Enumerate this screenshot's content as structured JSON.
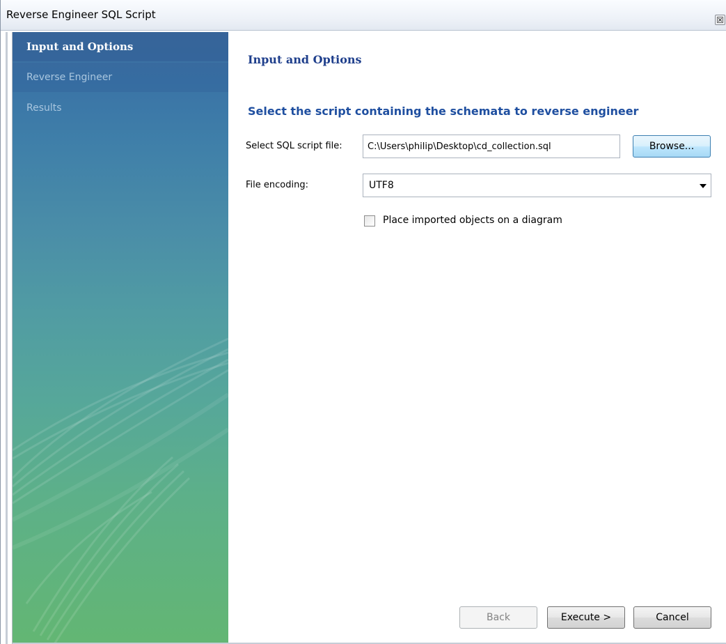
{
  "window": {
    "title": "Reverse Engineer SQL Script"
  },
  "sidebar": {
    "items": [
      {
        "label": "Input and Options",
        "active": true
      },
      {
        "label": "Reverse Engineer",
        "active": false
      },
      {
        "label": "Results",
        "active": false
      }
    ]
  },
  "main": {
    "page_title": "Input and Options",
    "section_heading": "Select the script containing the schemata to reverse engineer",
    "script_file_label": "Select SQL script file:",
    "script_file_value": "C:\\Users\\philip\\Desktop\\cd_collection.sql",
    "browse_label": "Browse...",
    "encoding_label": "File encoding:",
    "encoding_value": "UTF8",
    "checkbox_label": "Place imported objects on a diagram",
    "checkbox_checked": false
  },
  "footer": {
    "back_label": "Back",
    "execute_label": "Execute >",
    "cancel_label": "Cancel"
  },
  "colors": {
    "heading": "#1f3f8c",
    "sidebar_top": "#3f6fa0",
    "sidebar_bottom": "#63b673"
  },
  "icons": {
    "close": "close-icon",
    "dropdown": "chevron-down-icon"
  }
}
